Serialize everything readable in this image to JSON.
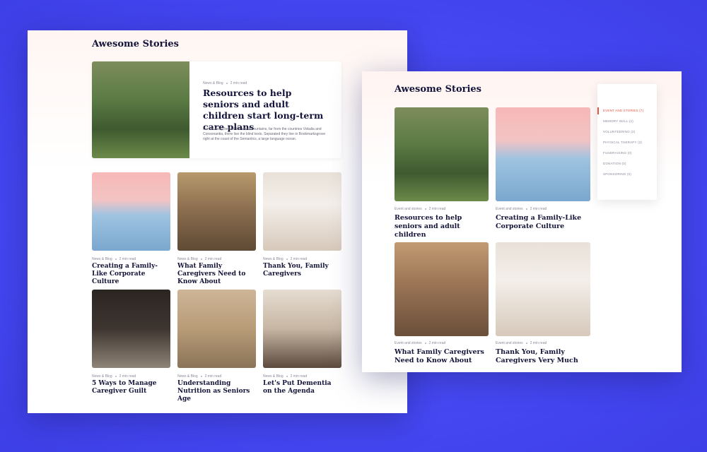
{
  "left_card": {
    "heading": "Awesome Stories",
    "featured": {
      "meta_category": "News & Blog",
      "meta_time": "2 min read",
      "title": "Resources to help seniors and adult children start long-term care plans",
      "excerpt": "Far far away, behind the word mountains, far from the countries Vokalia and Consonantia, there live the blind texts. Separated they live in Bookmarksgrove right at the coast of the Semantics, a large language ocean."
    },
    "posts": [
      {
        "meta_category": "News & Blog",
        "meta_time": "2 min read",
        "title": "Creating a Family-Like Corporate Culture"
      },
      {
        "meta_category": "News & Blog",
        "meta_time": "2 min read",
        "title": "What Family Caregivers Need to Know About"
      },
      {
        "meta_category": "News & Blog",
        "meta_time": "2 min read",
        "title": "Thank You, Family Caregivers"
      },
      {
        "meta_category": "News & Blog",
        "meta_time": "2 min read",
        "title": "5 Ways to Manage Caregiver Guilt"
      },
      {
        "meta_category": "News & Blog",
        "meta_time": "2 min read",
        "title": "Understanding Nutrition as Seniors Age"
      },
      {
        "meta_category": "News & Blog",
        "meta_time": "2 min read",
        "title": "Let's Put Dementia on the Agenda"
      }
    ]
  },
  "right_card": {
    "heading": "Awesome Stories",
    "posts": [
      {
        "meta_category": "Event and stories",
        "meta_time": "2 min read",
        "title": "Resources to help seniors and adult children"
      },
      {
        "meta_category": "Event and stories",
        "meta_time": "2 min read",
        "title": "Creating a Family-Like Corporate Culture"
      },
      {
        "meta_category": "Event and stories",
        "meta_time": "2 min read",
        "title": "What Family Caregivers Need to Know About"
      },
      {
        "meta_category": "Event and stories",
        "meta_time": "2 min read",
        "title": "Thank You, Family Caregivers Very Much"
      }
    ],
    "sidebar": {
      "items": [
        {
          "label": "Event and stories (7)",
          "active": true
        },
        {
          "label": "Memory wall (1)",
          "active": false
        },
        {
          "label": "Volunteering (2)",
          "active": false
        },
        {
          "label": "Physical therapy (3)",
          "active": false
        },
        {
          "label": "Fundraising (0)",
          "active": false
        },
        {
          "label": "Donation (0)",
          "active": false
        },
        {
          "label": "Sponsoring (0)",
          "active": false
        }
      ]
    }
  },
  "colors": {
    "background": "#4a4cf2",
    "accent": "#e2553e",
    "title_text": "#14143a"
  }
}
